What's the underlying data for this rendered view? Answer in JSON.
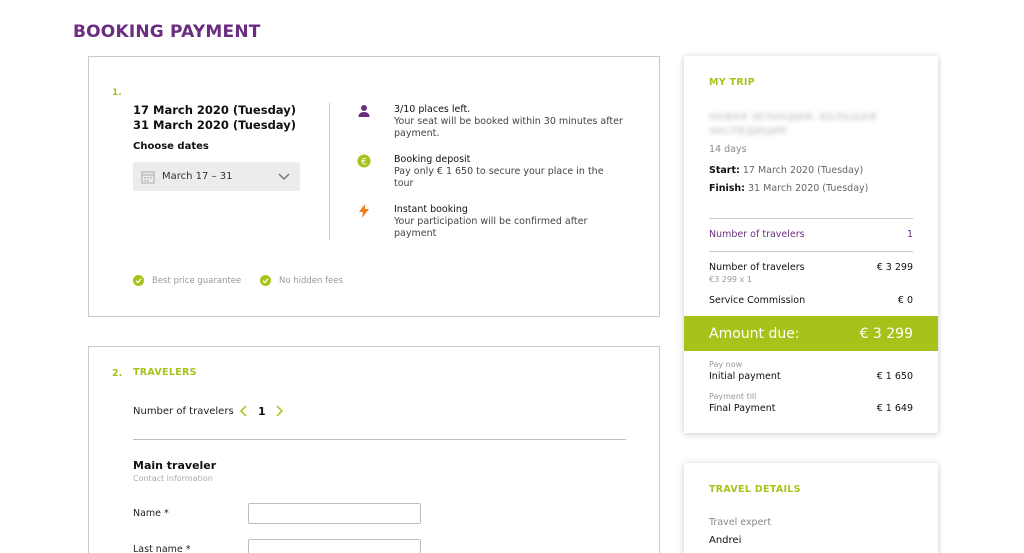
{
  "page": {
    "title": "BOOKING PAYMENT"
  },
  "dates_section": {
    "step": "1.",
    "date_from": "17 March 2020 (Tuesday)",
    "date_to": "31 March 2020 (Tuesday)",
    "choose_label": "Choose dates",
    "selected_range": "March 17 – 31",
    "features": [
      {
        "icon": "person-icon",
        "title": "3/10 places left.",
        "desc": "Your seat will be booked within 30 minutes after payment."
      },
      {
        "icon": "euro-coin-icon",
        "title": "Booking deposit",
        "desc": "Pay only € 1 650 to secure your place in the tour"
      },
      {
        "icon": "lightning-icon",
        "title": "Instant booking",
        "desc": "Your participation will be confirmed after payment"
      }
    ],
    "guarantees": [
      "Best price guarantee",
      "No hidden fees"
    ]
  },
  "travelers_section": {
    "step": "2.",
    "heading": "TRAVELERS",
    "count_label": "Number of travelers",
    "count": "1",
    "main_traveler": "Main traveler",
    "contact_info": "Contact information",
    "fields": [
      {
        "label": "Name *",
        "value": ""
      },
      {
        "label": "Last name *",
        "value": ""
      }
    ]
  },
  "my_trip": {
    "heading": "MY TRIP",
    "tour_name": "НОВАЯ ЗЕЛАНДИЯ: БОЛЬШАЯ ЭКСПЕДИЦИЯ",
    "duration": "14 days",
    "start_label": "Start:",
    "start_value": "17 March 2020 (Tuesday)",
    "finish_label": "Finish:",
    "finish_value": "31 March 2020 (Tuesday)",
    "travelers_label": "Number of travelers",
    "travelers_value": "1",
    "price_label": "Number of travelers",
    "price_value": "€ 3 299",
    "price_note": "€3 299 x 1",
    "commission_label": "Service Commission",
    "commission_value": "€ 0",
    "amount_label": "Amount due:",
    "amount_value": "€ 3 299",
    "pay_now_note": "Pay now",
    "initial_label": "Initial payment",
    "initial_value": "€ 1 650",
    "payment_till_note": "Payment till",
    "final_label": "Final Payment",
    "final_value": "€ 1 649"
  },
  "travel_details": {
    "heading": "TRAVEL DETAILS",
    "expert_label": "Travel expert",
    "expert_name": "Andrei"
  },
  "colors": {
    "brand_purple": "#6b2d82",
    "accent_green": "#a7c31b",
    "lightning_orange": "#f07d1a"
  }
}
